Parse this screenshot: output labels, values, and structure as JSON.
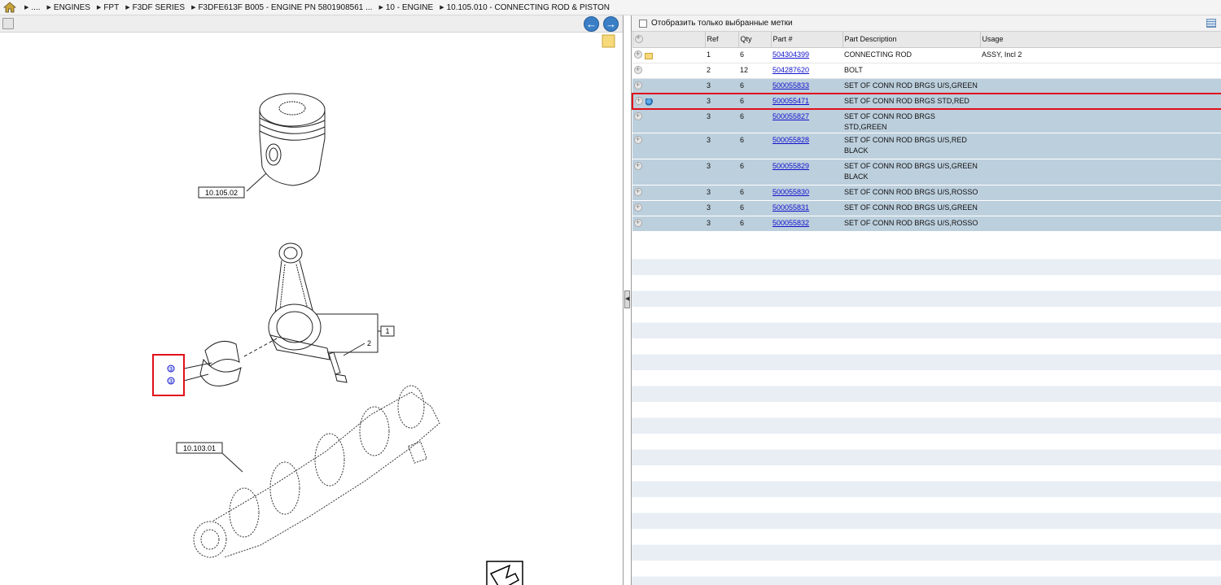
{
  "breadcrumb": {
    "items": [
      "....",
      "ENGINES",
      "FPT",
      "F3DF SERIES",
      "F3DFE613F B005 - ENGINE PN 5801908561 ...",
      "10 - ENGINE",
      "10.105.010 - CONNECTING ROD & PISTON"
    ]
  },
  "left_panel": {
    "nav_back_icon": "arrow-left-icon",
    "nav_forward_icon": "arrow-right-icon",
    "note_icon": "note-icon",
    "drawing": {
      "callouts": [
        "10.105.02",
        "1",
        "2",
        "10.103.01"
      ],
      "hotspots": [
        "3",
        "3"
      ]
    },
    "exit_icon": "exit-arrow-icon"
  },
  "right_panel": {
    "filter_label": "Отобразить только выбранные метки",
    "filter_checked": false,
    "columns": [
      "",
      "Ref",
      "Qty",
      "Part #",
      "Part Description",
      "Usage"
    ],
    "rows": [
      {
        "icon": "folder-icon",
        "ref": "1",
        "qty": "6",
        "part": "504304399",
        "desc": "CONNECTING ROD",
        "usage": "ASSY, Incl 2",
        "style": "white"
      },
      {
        "icon": "",
        "ref": "2",
        "qty": "12",
        "part": "504287620",
        "desc": "BOLT",
        "usage": "",
        "style": "white"
      },
      {
        "icon": "",
        "ref": "3",
        "qty": "6",
        "part": "500055833",
        "desc": "SET OF CONN ROD BRGS U/S,GREEN",
        "usage": "",
        "style": "blue"
      },
      {
        "icon": "pin-icon",
        "ref": "3",
        "qty": "6",
        "part": "500055471",
        "desc": "SET OF CONN ROD BRGS STD,RED",
        "usage": "",
        "style": "blue selected"
      },
      {
        "icon": "",
        "ref": "3",
        "qty": "6",
        "part": "500055827",
        "desc": "SET OF CONN ROD BRGS STD,GREEN",
        "usage": "",
        "style": "blue"
      },
      {
        "icon": "",
        "ref": "3",
        "qty": "6",
        "part": "500055828",
        "desc": "SET OF CONN ROD BRGS U/S,RED BLACK",
        "usage": "",
        "style": "blue tall"
      },
      {
        "icon": "",
        "ref": "3",
        "qty": "6",
        "part": "500055829",
        "desc": "SET OF CONN ROD BRGS U/S,GREEN BLACK",
        "usage": "",
        "style": "blue tall"
      },
      {
        "icon": "",
        "ref": "3",
        "qty": "6",
        "part": "500055830",
        "desc": "SET OF CONN ROD BRGS U/S,ROSSO",
        "usage": "",
        "style": "blue"
      },
      {
        "icon": "",
        "ref": "3",
        "qty": "6",
        "part": "500055831",
        "desc": "SET OF CONN ROD BRGS U/S,GREEN",
        "usage": "",
        "style": "blue"
      },
      {
        "icon": "",
        "ref": "3",
        "qty": "6",
        "part": "500055832",
        "desc": "SET OF CONN ROD BRGS U/S,ROSSO",
        "usage": "",
        "style": "blue"
      }
    ]
  },
  "colors": {
    "row_highlight": "#bccfdd",
    "selection_border": "#e0101a",
    "link": "#1111cc"
  }
}
